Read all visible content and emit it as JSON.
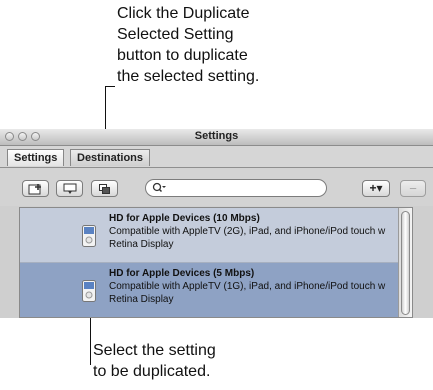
{
  "callouts": {
    "top": [
      "Click the Duplicate",
      "Selected Setting",
      "button to duplicate",
      "the selected setting."
    ],
    "bottom": [
      "Select the setting",
      "to be duplicated."
    ]
  },
  "window": {
    "title": "Settings"
  },
  "tabs": [
    {
      "label": "Settings",
      "active": true
    },
    {
      "label": "Destinations",
      "active": false
    }
  ],
  "toolbar": {
    "buttons": [
      {
        "name": "new-setting-button",
        "icon": "add-document-icon"
      },
      {
        "name": "new-group-button",
        "icon": "folder-icon"
      },
      {
        "name": "duplicate-selected-setting-button",
        "icon": "duplicate-icon"
      }
    ],
    "search": {
      "value": "",
      "placeholder": ""
    },
    "add_menu_label": "+▾",
    "remove_label": "−"
  },
  "settings": [
    {
      "title": "HD for Apple Devices (10 Mbps)",
      "line1": "Compatible with AppleTV (2G), iPad, and iPhone/iPod touch w",
      "line2": "Retina Display",
      "selected": false
    },
    {
      "title": "HD for Apple Devices (5 Mbps)",
      "line1": "Compatible with AppleTV (1G), iPad, and iPhone/iPod touch w",
      "line2": "Retina Display",
      "selected": true
    }
  ]
}
